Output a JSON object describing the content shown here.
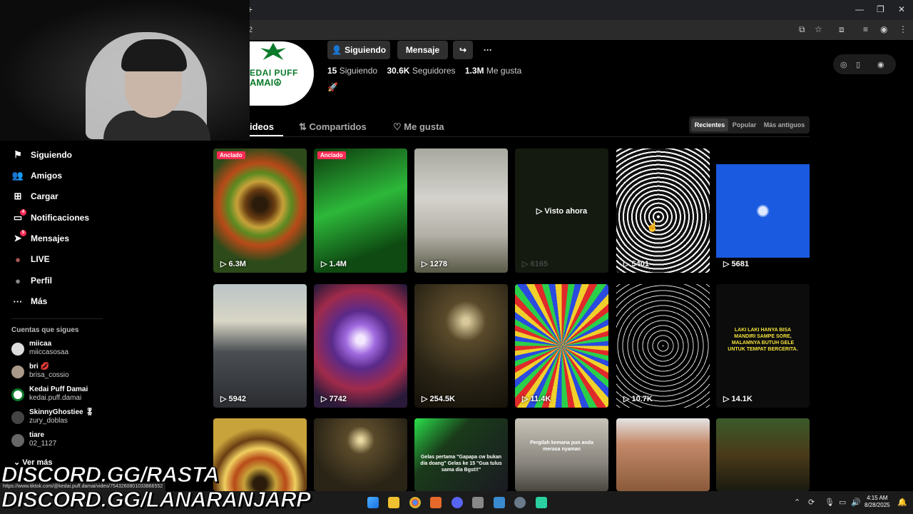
{
  "browser": {
    "new_tab": "+",
    "url": "2",
    "win_min": "—",
    "win_max": "❐",
    "win_close": "✕"
  },
  "profile": {
    "logo_line1": "EDAI PUFF",
    "logo_line2": "AMAI☮",
    "following_btn": "Siguiendo",
    "message_btn": "Mensaje",
    "share_icon": "↪",
    "more_icon": "···",
    "following_count": "15",
    "following_label": "Siguiendo",
    "followers_count": "30.6K",
    "followers_label": "Seguidores",
    "likes_count": "1.3M",
    "likes_label": "Me gusta",
    "bio_icon": "🚀"
  },
  "tabs": {
    "videos": "ideos",
    "shared": "Compartidos",
    "liked": "Me gusta"
  },
  "sort": {
    "recent": "Recientes",
    "popular": "Popular",
    "oldest": "Más antiguos"
  },
  "sidebar": {
    "items": [
      {
        "label": "Siguiendo",
        "icon": "⚑",
        "badge": ""
      },
      {
        "label": "Amigos",
        "icon": "👥",
        "badge": ""
      },
      {
        "label": "Cargar",
        "icon": "⊞",
        "badge": ""
      },
      {
        "label": "Notificaciones",
        "icon": "▭",
        "badge": "4"
      },
      {
        "label": "Mensajes",
        "icon": "➤",
        "badge": "5"
      },
      {
        "label": "LIVE",
        "icon": "●",
        "badge": ""
      },
      {
        "label": "Perfil",
        "icon": "●",
        "badge": ""
      },
      {
        "label": "Más",
        "icon": "···",
        "badge": ""
      }
    ],
    "following_title": "Cuentas que sigues",
    "following": [
      {
        "name": "miicaa",
        "handle": "miiccasosaa"
      },
      {
        "name": "bri 💋",
        "handle": "brisa_cossio"
      },
      {
        "name": "Kedai Puff Damai",
        "handle": "kedai.puff.damai"
      },
      {
        "name": "SkinnyGhostiee 🎖",
        "handle": "zury_doblas"
      },
      {
        "name": "tiare",
        "handle": "02_1127"
      }
    ],
    "see_more": "⌄   Ver más"
  },
  "videos": [
    {
      "views": "▷ 6.3M",
      "pinned": "Anclado"
    },
    {
      "views": "▷ 1.4M",
      "pinned": "Anclado"
    },
    {
      "views": "▷ 1278",
      "pinned": ""
    },
    {
      "views": "▷ 6165",
      "pinned": "",
      "overlay": "▷ Visto ahora"
    },
    {
      "views": "▷ 5401",
      "pinned": ""
    },
    {
      "views": "▷ 5681",
      "pinned": ""
    },
    {
      "views": "▷ 5942",
      "pinned": ""
    },
    {
      "views": "▷ 7742",
      "pinned": ""
    },
    {
      "views": "▷ 254.5K",
      "pinned": ""
    },
    {
      "views": "▷ 11.4K",
      "pinned": ""
    },
    {
      "views": "▷ 10.7K",
      "pinned": ""
    },
    {
      "views": "▷ 14.1K",
      "pinned": "",
      "caption": "LAKI LAKI HANYA BISA MANDIRI SAMPE SORE, MALAMNYA BUTUH GELE UNTUK TEMPAT BERCERITA."
    },
    {
      "views": "",
      "pinned": ""
    },
    {
      "views": "",
      "pinned": ""
    },
    {
      "views": "",
      "pinned": "",
      "caption": "Gelas pertama \"Gapapa cw bukan dia doang\" Gelas ke 15 \"Gua tulus sama dia Bgst!!\""
    },
    {
      "views": "",
      "pinned": "",
      "caption": "Pergilah kemana pun anda merasa nyaman"
    },
    {
      "views": "",
      "pinned": ""
    },
    {
      "views": "",
      "pinned": ""
    }
  ],
  "overlay": {
    "discord1": "DISCORD.GG/RASTA",
    "discord2": "DISCORD.GG/LANARANJARP",
    "status_url": "https://www.tiktok.com/@kedai.puff.damai/video/7543260801033866552"
  },
  "taskbar": {
    "time": "4:15 AM",
    "date": "8/28/2025"
  }
}
